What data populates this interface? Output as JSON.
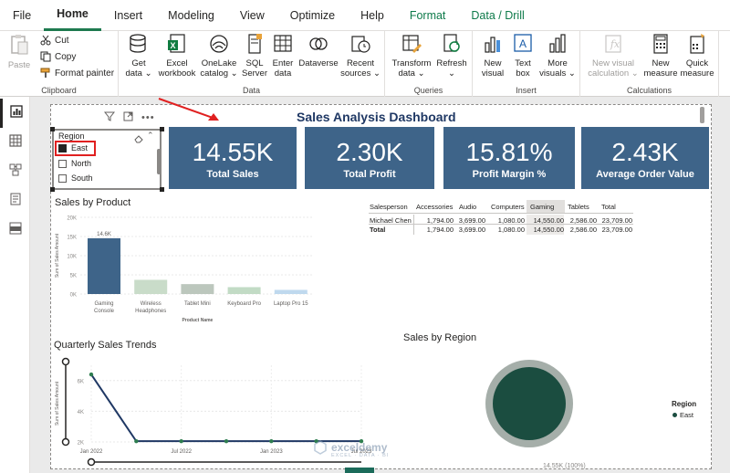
{
  "menu": {
    "items": [
      "File",
      "Home",
      "Insert",
      "Modeling",
      "View",
      "Optimize",
      "Help",
      "Format",
      "Data / Drill"
    ],
    "active": "Home"
  },
  "ribbon": {
    "clipboard": {
      "label": "Clipboard",
      "paste": "Paste",
      "cut": "Cut",
      "copy": "Copy",
      "format_painter": "Format painter"
    },
    "data": {
      "label": "Data",
      "buttons": [
        {
          "line1": "Get",
          "line2": "data ⌄"
        },
        {
          "line1": "Excel",
          "line2": "workbook"
        },
        {
          "line1": "OneLake",
          "line2": "catalog ⌄"
        },
        {
          "line1": "SQL",
          "line2": "Server"
        },
        {
          "line1": "Enter",
          "line2": "data"
        },
        {
          "line1": "Dataverse",
          "line2": ""
        },
        {
          "line1": "Recent",
          "line2": "sources ⌄"
        }
      ]
    },
    "queries": {
      "label": "Queries",
      "buttons": [
        {
          "line1": "Transform",
          "line2": "data ⌄"
        },
        {
          "line1": "Refresh",
          "line2": "⌄"
        }
      ]
    },
    "insert": {
      "label": "Insert",
      "buttons": [
        {
          "line1": "New",
          "line2": "visual"
        },
        {
          "line1": "Text",
          "line2": "box"
        },
        {
          "line1": "More",
          "line2": "visuals ⌄"
        }
      ]
    },
    "calculations": {
      "label": "Calculations",
      "buttons": [
        {
          "line1": "New visual",
          "line2": "calculation ⌄",
          "disabled": true
        },
        {
          "line1": "New",
          "line2": "measure"
        },
        {
          "line1": "Quick",
          "line2": "measure"
        }
      ]
    }
  },
  "dashboard": {
    "title": "Sales Analysis Dashboard",
    "kpis": [
      {
        "value": "14.55K",
        "label": "Total Sales"
      },
      {
        "value": "2.30K",
        "label": "Total Profit"
      },
      {
        "value": "15.81%",
        "label": "Profit Margin %"
      },
      {
        "value": "2.43K",
        "label": "Average Order Value"
      }
    ],
    "slicer": {
      "title": "Region",
      "options": [
        {
          "label": "East",
          "checked": true
        },
        {
          "label": "North",
          "checked": false
        },
        {
          "label": "South",
          "checked": false
        }
      ]
    },
    "matrix": {
      "headers": [
        "Salesperson",
        "Accessories",
        "Audio",
        "Computers",
        "Gaming",
        "Tablets",
        "Total"
      ],
      "rows": [
        [
          "Michael Chen",
          "1,794.00",
          "3,699.00",
          "1,080.00",
          "14,550.00",
          "2,586.00",
          "23,709.00"
        ],
        [
          "Total",
          "1,794.00",
          "3,699.00",
          "1,080.00",
          "14,550.00",
          "2,586.00",
          "23,709.00"
        ]
      ]
    },
    "region_chart": {
      "title": "Sales by Region",
      "legend_title": "Region",
      "legend_item": "East",
      "partial_label": "14.55K (100%)"
    },
    "watermark": {
      "brand": "exceldemy",
      "tagline": "EXCEL · DATA · BI"
    }
  },
  "chart_data": [
    {
      "type": "bar",
      "title": "Sales by Product",
      "xlabel": "Product Name",
      "ylabel": "Sum of Sales Amount",
      "categories": [
        "Gaming Console",
        "Wireless Headphones",
        "Tablet Mini",
        "Keyboard Pro",
        "Laptop Pro 15"
      ],
      "category_lines": [
        [
          "Gaming",
          "Console"
        ],
        [
          "Wireless",
          "Headphones"
        ],
        [
          "Tablet Mini"
        ],
        [
          "Keyboard Pro"
        ],
        [
          "Laptop Pro 15"
        ]
      ],
      "values": [
        14550,
        3699,
        2586,
        1794,
        1080
      ],
      "data_labels": [
        "14.6K",
        "",
        "",
        "",
        ""
      ],
      "highlighted_index": 0,
      "y_ticks": [
        "0K",
        "5K",
        "10K",
        "15K",
        "20K"
      ],
      "ylim": [
        0,
        20000
      ],
      "colors": {
        "highlight": "#3e6489",
        "dim": [
          "#c9dcc9",
          "#bcc7bd",
          "#c2dbc5",
          "#bfd9ee"
        ]
      }
    },
    {
      "type": "line",
      "title": "Quarterly Sales Trends",
      "ylabel": "Sum of Sales Amount",
      "x": [
        "2022-01",
        "2022-04",
        "2022-07",
        "2022-10",
        "2023-01",
        "2023-04",
        "2023-07"
      ],
      "values": [
        6400,
        2050,
        2050,
        2050,
        2050,
        2050,
        2050
      ],
      "x_ticks": [
        "Jan 2022",
        "Jul 2022",
        "Jan 2023",
        "Jul 2023"
      ],
      "y_ticks": [
        "2K",
        "4K",
        "6K"
      ],
      "ylim": [
        2000,
        7000
      ],
      "color": "#1f3864"
    },
    {
      "type": "pie",
      "title": "Sales by Region",
      "categories": [
        "East"
      ],
      "values": [
        14550
      ],
      "colors": {
        "slice": "#1b4d40",
        "ring": "#a5aea9"
      }
    }
  ]
}
